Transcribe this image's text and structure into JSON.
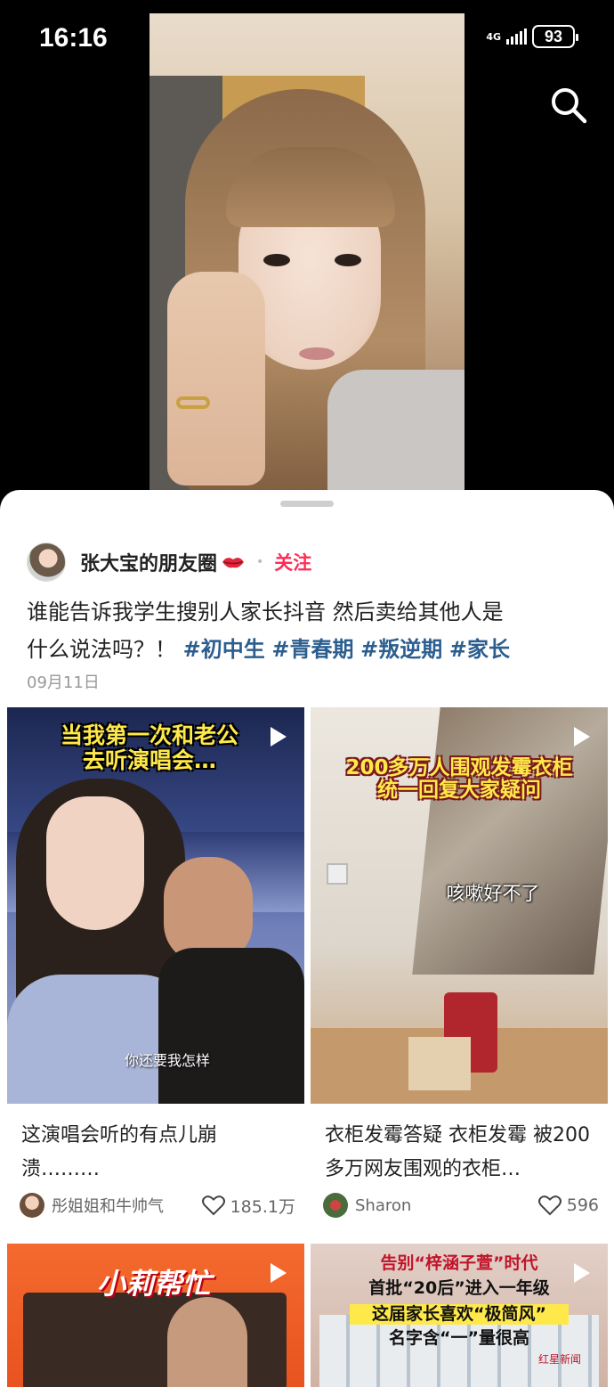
{
  "status": {
    "time": "16:16",
    "network": "4G",
    "battery": "93"
  },
  "post": {
    "author": "张大宝的朋友圈",
    "follow_label": "关注",
    "text_line1": "谁能告诉我学生搜别人家长抖音 然后卖给其他人是",
    "text_line2_plain": "什么说法吗？！",
    "tags": [
      "#初中生",
      "#青春期",
      "#叛逆期",
      "#家长"
    ],
    "date": "09月11日"
  },
  "cards": [
    {
      "overlay_title": "当我第一次和老公去听演唱会…",
      "overlay_title_line1": "当我第一次和老公",
      "overlay_title_line2": "去听演唱会…",
      "subtitle": "你还要我怎样",
      "title": "这演唱会听的有点儿崩溃………",
      "author": "彤姐姐和牛帅气",
      "likes": "185.1万"
    },
    {
      "overlay_title_line1": "200多万人围观发霉衣柜",
      "overlay_title_line2": "统一回复大家疑问",
      "subtitle": "咳嗽好不了",
      "title": "衣柜发霉答疑 衣柜发霉 被200多万网友围观的衣柜…",
      "author": "Sharon",
      "likes": "596"
    },
    {
      "overlay_title": "小莉帮忙"
    },
    {
      "overlay_line1": "告别“梓涵子萱”时代",
      "overlay_line2": "首批“20后”进入一年级",
      "overlay_line3": "这届家长喜欢“极简风”",
      "overlay_line4": "名字含“一”量很高",
      "watermark": "红星新闻"
    }
  ],
  "icons": {
    "search": "search-icon",
    "play": "play-icon",
    "heart": "heart-icon",
    "lips": "lips-emoji-icon"
  },
  "colors": {
    "follow": "#fe2c55",
    "hashtag": "#2b5e8f",
    "overlay_yellow": "#ffe94a"
  }
}
